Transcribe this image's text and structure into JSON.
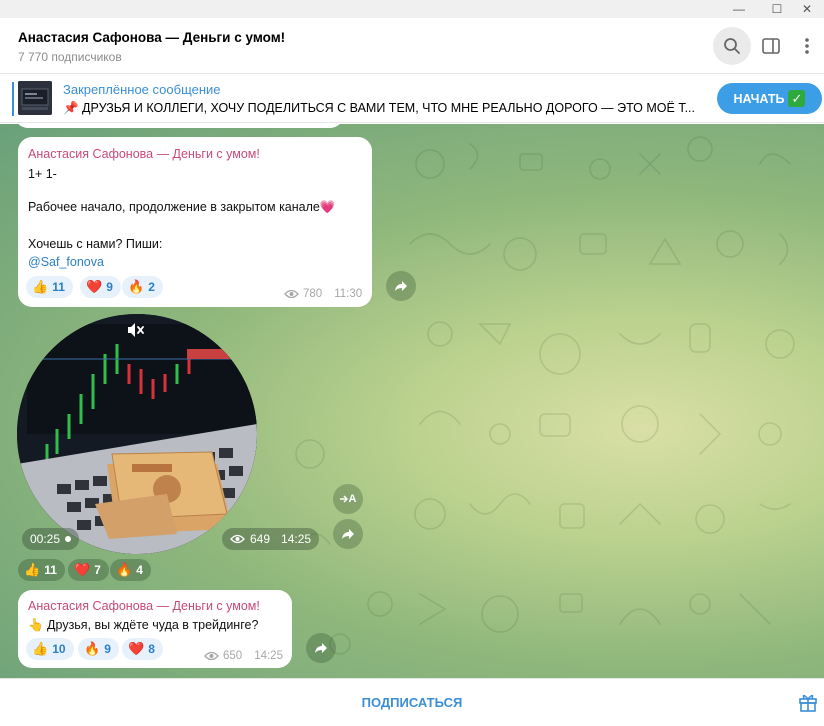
{
  "window": {
    "minimize": "—",
    "maximize": "☐",
    "close": "✕"
  },
  "header": {
    "title": "Анастасия Сафонова — Деньги с умом!",
    "subscribers": "7 770 подписчиков"
  },
  "pinned": {
    "title": "Закреплённое сообщение",
    "text": "📌 ДРУЗЬЯ И КОЛЛЕГИ, ХОЧУ ПОДЕЛИТЬСЯ С ВАМИ ТЕМ, ЧТО МНЕ РЕАЛЬНО ДОРОГО — ЭТО МОЁ Т...",
    "button_label": "НАЧАТЬ",
    "button_check": "✓"
  },
  "messages": [
    {
      "author": "Анастасия Сафонова — Деньги с умом!",
      "lines": [
        "1+ 1-",
        "Рабочее начало, продолжение в закрытом канале💗",
        "Хочешь с нами? Пиши:"
      ],
      "link": "@Saf_fonova",
      "reactions": [
        {
          "emoji": "👍",
          "count": "11"
        },
        {
          "emoji": "❤️",
          "count": "9"
        },
        {
          "emoji": "🔥",
          "count": "2"
        }
      ],
      "views": "780",
      "time": "11:30"
    },
    {
      "type": "video",
      "duration": "00:25",
      "views": "649",
      "time": "14:25",
      "translate_label": "A",
      "reactions": [
        {
          "emoji": "👍",
          "count": "11"
        },
        {
          "emoji": "❤️",
          "count": "7"
        },
        {
          "emoji": "🔥",
          "count": "4"
        }
      ]
    },
    {
      "author": "Анастасия Сафонова — Деньги с умом!",
      "lines": [
        "👆 Друзья, вы ждёте чуда в трейдинге?"
      ],
      "reactions": [
        {
          "emoji": "👍",
          "count": "10"
        },
        {
          "emoji": "🔥",
          "count": "9"
        },
        {
          "emoji": "❤️",
          "count": "8"
        }
      ],
      "views": "650",
      "time": "14:25"
    }
  ],
  "footer": {
    "subscribe_label": "ПОДПИСАТЬСЯ"
  },
  "colors": {
    "accent": "#3a8fd6",
    "author": "#c84a7a",
    "start_button": "#3c9ee6"
  }
}
